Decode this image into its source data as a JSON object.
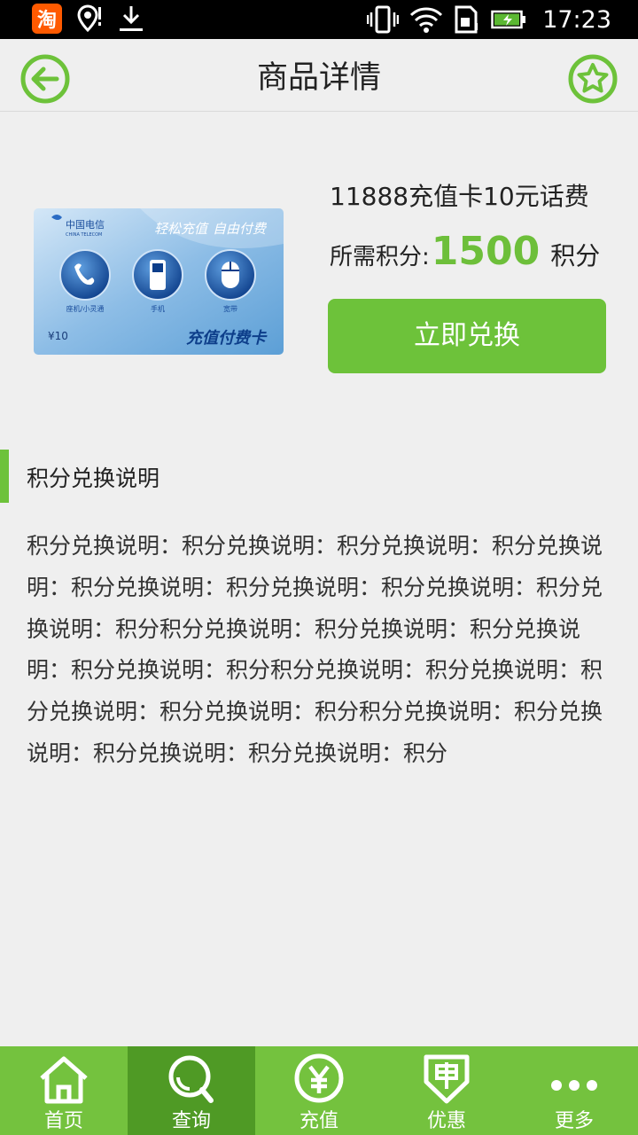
{
  "status_bar": {
    "time": "17:23",
    "app_badge": "淘"
  },
  "header": {
    "title": "商品详情"
  },
  "product": {
    "name": "11888充值卡10元话费",
    "points_label": "所需积分:",
    "points_value": "1500",
    "points_unit": "积分",
    "redeem_label": "立即兑换",
    "card": {
      "brand_cn": "中国电信",
      "brand_en": "CHINA TELECOM",
      "slogan_1": "轻松充值",
      "slogan_2": "自由付费",
      "icon_labels": [
        "座机/小灵通",
        "手机",
        "宽带"
      ],
      "value": "¥10",
      "card_name": "充值付费卡"
    }
  },
  "section": {
    "title": "积分兑换说明",
    "description": "积分兑换说明：积分兑换说明：积分兑换说明：积分兑换说明：积分兑换说明：积分兑换说明：积分兑换说明：积分兑换说明：积分积分兑换说明：积分兑换说明：积分兑换说明：积分兑换说明：积分积分兑换说明：积分兑换说明：积分兑换说明：积分兑换说明：积分积分兑换说明：积分兑换说明：积分兑换说明：积分兑换说明：积分"
  },
  "bottom_nav": [
    {
      "label": "首页",
      "icon": "home-icon",
      "active": false
    },
    {
      "label": "查询",
      "icon": "search-icon",
      "active": true
    },
    {
      "label": "充值",
      "icon": "yuan-icon",
      "active": false
    },
    {
      "label": "优惠",
      "icon": "discount-tag-icon",
      "active": false
    },
    {
      "label": "更多",
      "icon": "more-dots-icon",
      "active": false
    }
  ],
  "colors": {
    "accent": "#6dc23a",
    "nav_bg": "#74c23e",
    "nav_active": "#4f9a25",
    "points": "#6dbf3a"
  }
}
